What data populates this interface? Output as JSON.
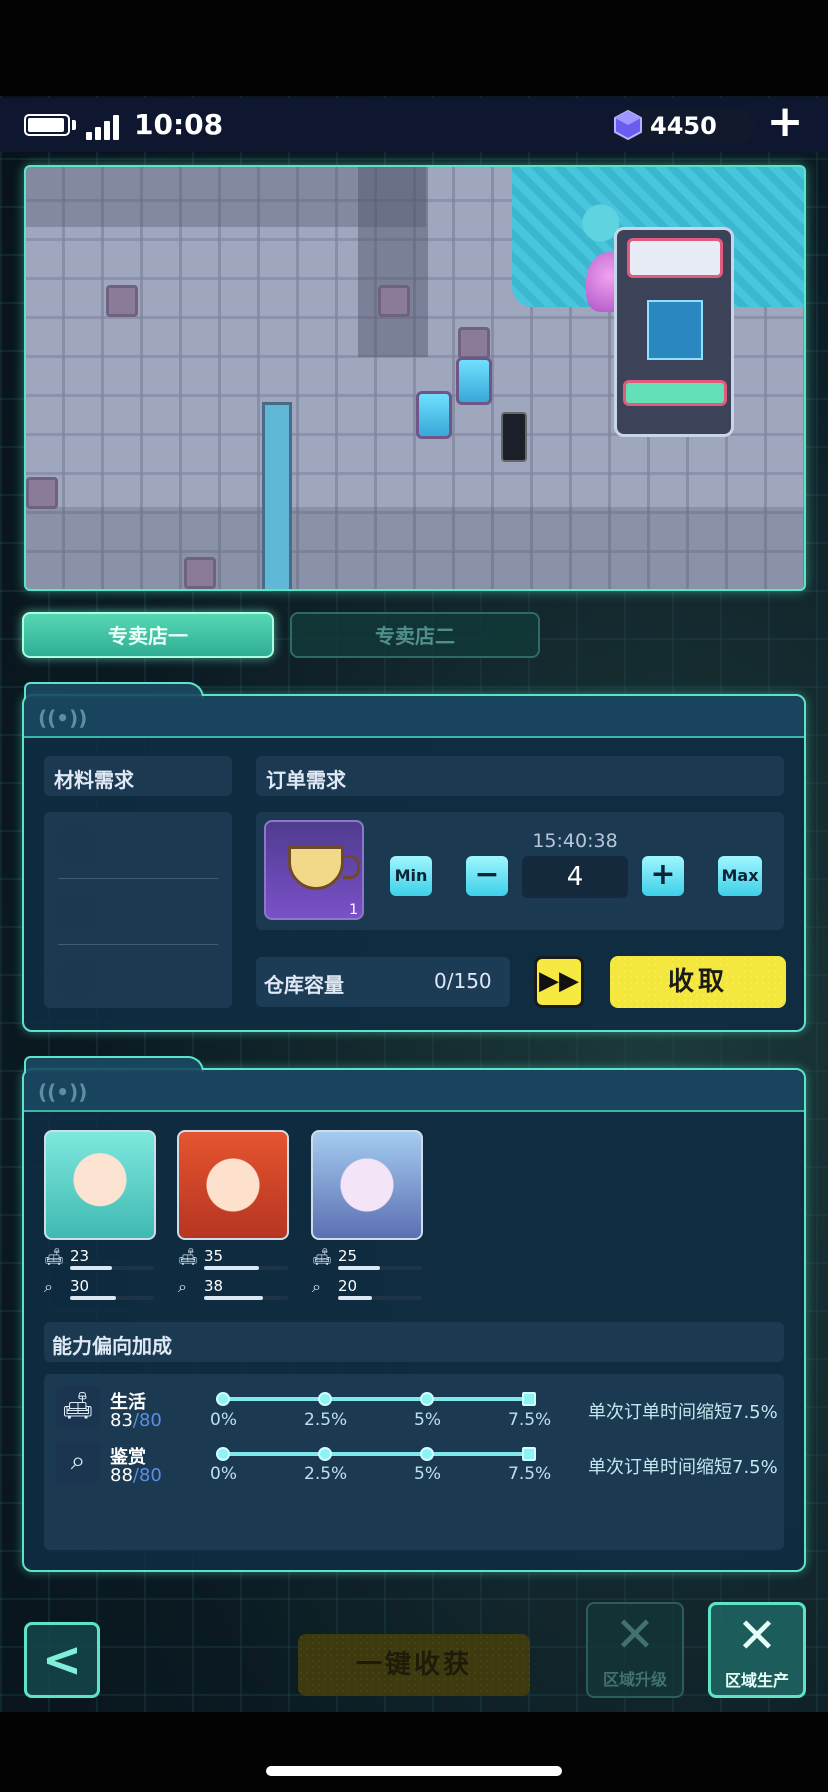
{
  "status": {
    "time": "10:08"
  },
  "currency": {
    "gems": "4450",
    "add_icon": "plus-icon"
  },
  "tabs": [
    {
      "label": "专卖店一",
      "active": true
    },
    {
      "label": "专卖店二",
      "active": false
    }
  ],
  "order_panel": {
    "materials_title": "材料需求",
    "order_title": "订单需求",
    "item": {
      "icon": "teacup-icon",
      "count": "1"
    },
    "timer": "15:40:38",
    "min_label": "Min",
    "minus_label": "−",
    "quantity": "4",
    "plus_label": "+",
    "max_label": "Max",
    "storage_label": "仓库容量",
    "storage_value": "0/150",
    "fast_forward": "▶▶",
    "collect_label": "收取"
  },
  "characters": [
    {
      "life": "23",
      "appraisal": "30",
      "life_fill": 0.5,
      "appraisal_fill": 0.55
    },
    {
      "life": "35",
      "appraisal": "38",
      "life_fill": 0.65,
      "appraisal_fill": 0.7
    },
    {
      "life": "25",
      "appraisal": "20",
      "life_fill": 0.5,
      "appraisal_fill": 0.4
    }
  ],
  "ability": {
    "title": "能力偏向加成",
    "rows": [
      {
        "icon": "sofa-icon",
        "name": "生活",
        "value": "83",
        "max": "/80",
        "desc": "单次订单时间缩短7.5%"
      },
      {
        "icon": "magnifier-icon",
        "name": "鉴赏",
        "value": "88",
        "max": "/80",
        "desc": "单次订单时间缩短7.5%"
      }
    ],
    "ticks": [
      "0%",
      "2.5%",
      "5%",
      "7.5%"
    ]
  },
  "bottom": {
    "back": "<",
    "harvest": "一键收获",
    "upgrade": "区域升级",
    "produce": "区域生产"
  },
  "colors": {
    "accent": "#5fe3c8",
    "yellow": "#f3e73d",
    "teal_button": "#3ed0e8"
  }
}
